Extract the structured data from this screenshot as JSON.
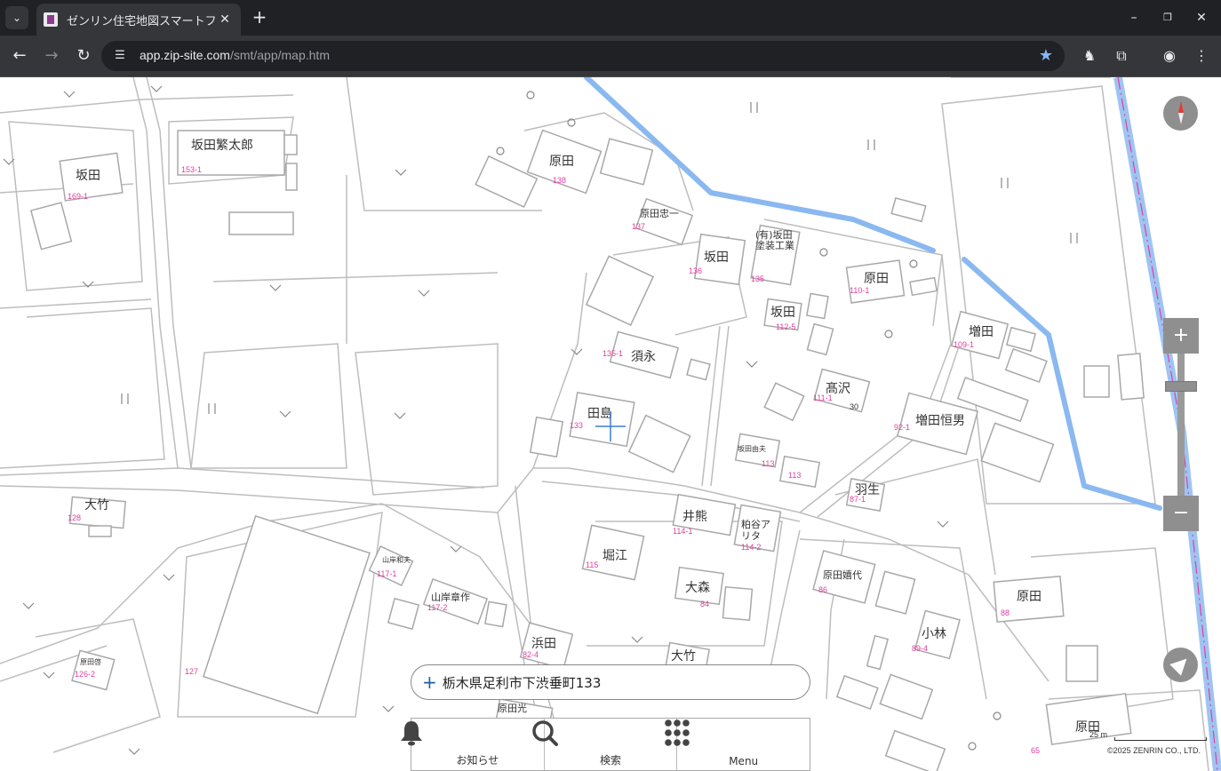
{
  "browser": {
    "tab_title": "ゼンリン住宅地図スマートフォン",
    "url_host": "app.zip-site.com",
    "url_path": "/smt/app/map.htm"
  },
  "map": {
    "address": "栃木県足利市下渋垂町133",
    "labels": [
      "坂田繁太郎",
      "坂田",
      "原田",
      "原田忠一",
      "坂田",
      "(有)坂田塗装工業",
      "原田",
      "坂田",
      "須永",
      "田島",
      "髙沢",
      "増田",
      "増田恒男",
      "大竹",
      "坂田由夫",
      "羽生",
      "井熊",
      "粕谷アリタ",
      "堀江",
      "原田嬉代",
      "原田",
      "大森",
      "小林",
      "山岸和夫",
      "山岸章作",
      "浜田",
      "大竹",
      "原田光",
      "原田啓",
      "原田"
    ],
    "lot_numbers": [
      "153-1",
      "169-1",
      "138",
      "137",
      "136",
      "135",
      "110-1",
      "112-5",
      "135-1",
      "109-1",
      "133",
      "111-1",
      "30",
      "92-1",
      "113",
      "113",
      "87-1",
      "128",
      "114-1",
      "114-2",
      "115",
      "117-1",
      "117-2",
      "86",
      "84",
      "88",
      "89-4",
      "82-4",
      "127",
      "126-2",
      "65"
    ],
    "scale_label": "25 m",
    "copyright": "©2025 ZENRIN CO., LTD."
  },
  "menu": {
    "notifications": "お知らせ",
    "search": "検索",
    "menu": "Menu"
  },
  "colors": {
    "river": "#8ab8f0",
    "lot_number": "#e040a0",
    "control_gray": "#8f8f8f"
  }
}
